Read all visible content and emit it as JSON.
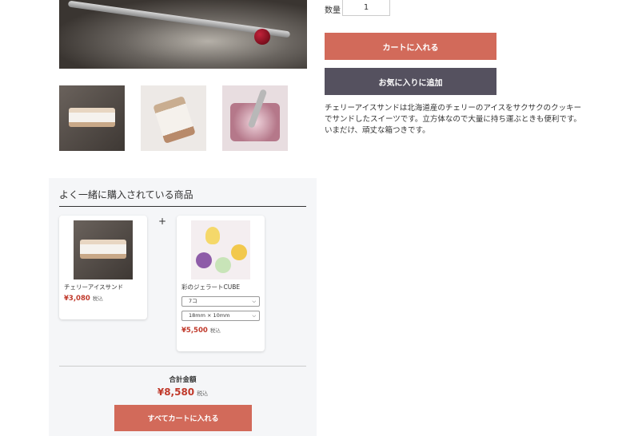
{
  "product": {
    "qty_label": "数量",
    "qty_value": "1",
    "add_to_cart": "カートに入れる",
    "add_to_favorites": "お気に入りに追加",
    "description": [
      "チェリーアイスサンドは北海道産のチェリーのアイスをサクサクのクッキーでサンドしたスイーツです。立方体なので大量に持ち運ぶときも便利です。",
      "いまだけ、頑丈な箱つきです。"
    ]
  },
  "bundle": {
    "title": "よく一緒に購入されている商品",
    "plus": "+",
    "items": [
      {
        "name": "チェリーアイスサンド",
        "price": "¥3,080",
        "tax": "税込"
      },
      {
        "name": "彩のジェラートCUBE",
        "price": "¥5,500",
        "tax": "税込",
        "option1": "7コ",
        "option2": "18mm × 10mm"
      }
    ],
    "total_label": "合計金額",
    "total_price": "¥8,580",
    "total_tax": "税込",
    "add_all": "すべてカートに入れる"
  },
  "colors": {
    "accent": "#d26a5a",
    "secondary": "#55515f",
    "price": "#c0392b",
    "panel": "#f5f6f8"
  }
}
